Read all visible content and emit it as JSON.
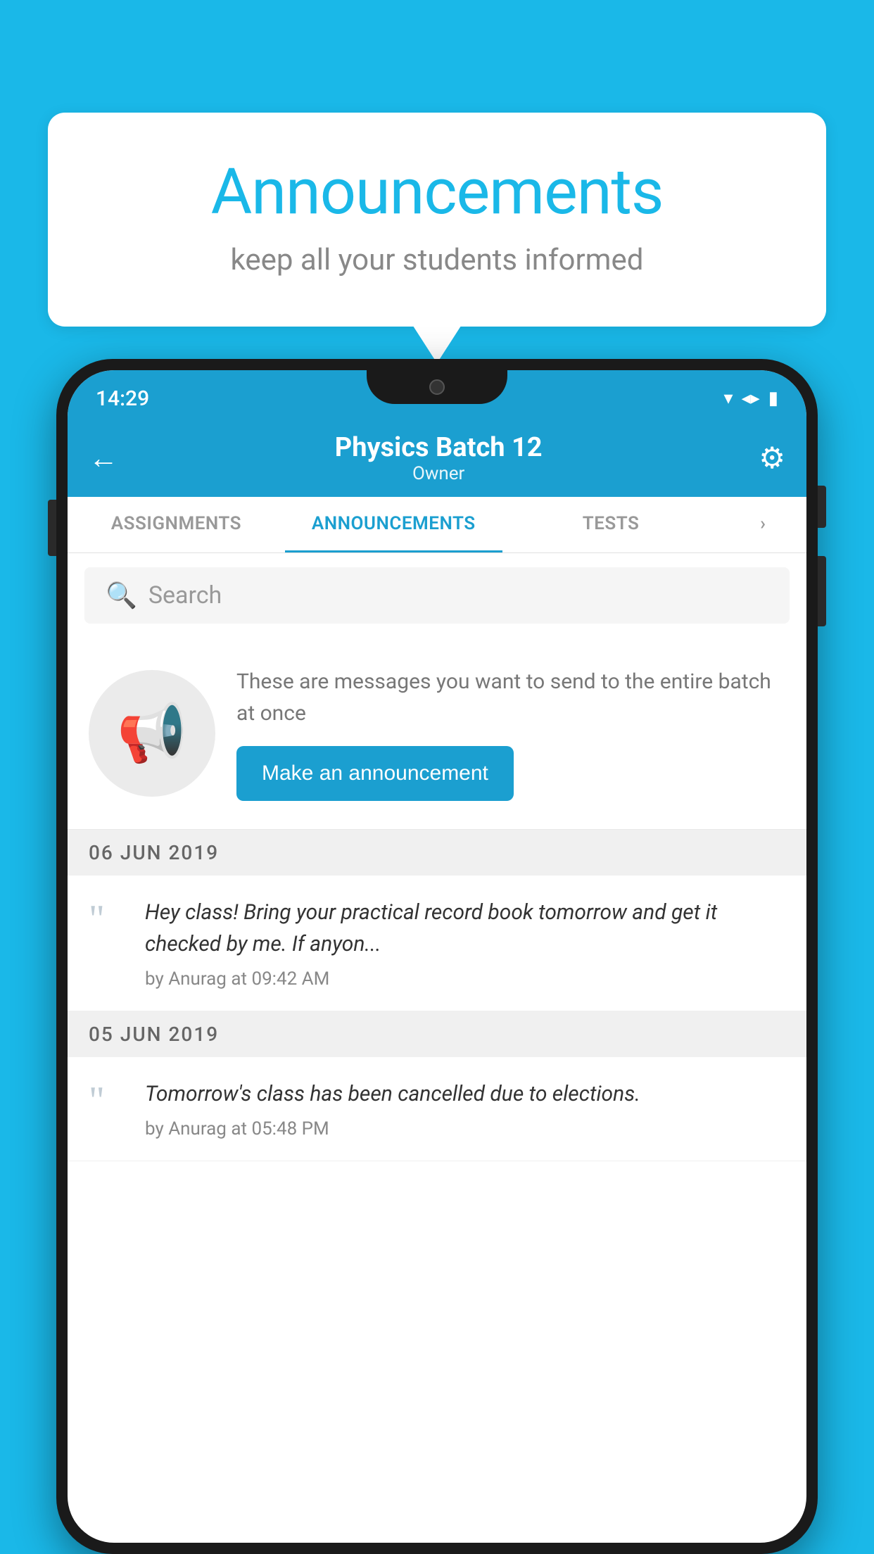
{
  "background_color": "#1ab8e8",
  "speech_bubble": {
    "title": "Announcements",
    "subtitle": "keep all your students informed"
  },
  "status_bar": {
    "time": "14:29",
    "wifi": "▼",
    "signal": "◀",
    "battery": "▌"
  },
  "header": {
    "title": "Physics Batch 12",
    "subtitle": "Owner",
    "back_label": "←",
    "gear_label": "⚙"
  },
  "tabs": [
    {
      "label": "ASSIGNMENTS",
      "active": false
    },
    {
      "label": "ANNOUNCEMENTS",
      "active": true
    },
    {
      "label": "TESTS",
      "active": false
    },
    {
      "label": "›",
      "active": false
    }
  ],
  "search": {
    "placeholder": "Search"
  },
  "promo": {
    "text": "These are messages you want to send to the entire batch at once",
    "button_label": "Make an announcement"
  },
  "announcements": [
    {
      "date": "06  JUN  2019",
      "text": "Hey class! Bring your practical record book tomorrow and get it checked by me. If anyon...",
      "author": "by Anurag at 09:42 AM"
    },
    {
      "date": "05  JUN  2019",
      "text": "Tomorrow's class has been cancelled due to elections.",
      "author": "by Anurag at 05:48 PM"
    }
  ]
}
